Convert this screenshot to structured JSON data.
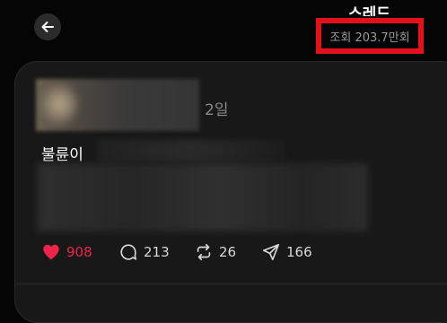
{
  "header": {
    "title": "스레드",
    "views_label": "조회 203.7만회"
  },
  "post": {
    "time_ago": "2일",
    "text_start": "불륜이",
    "actions": {
      "likes": "908",
      "comments": "213",
      "reposts": "26",
      "shares": "166"
    }
  },
  "colors": {
    "accent_red": "#e4101b",
    "like_red": "#f0244a",
    "background": "#050505",
    "card": "#181818"
  },
  "icons": [
    "back-arrow-icon",
    "heart-icon",
    "comment-icon",
    "repost-icon",
    "share-icon"
  ]
}
